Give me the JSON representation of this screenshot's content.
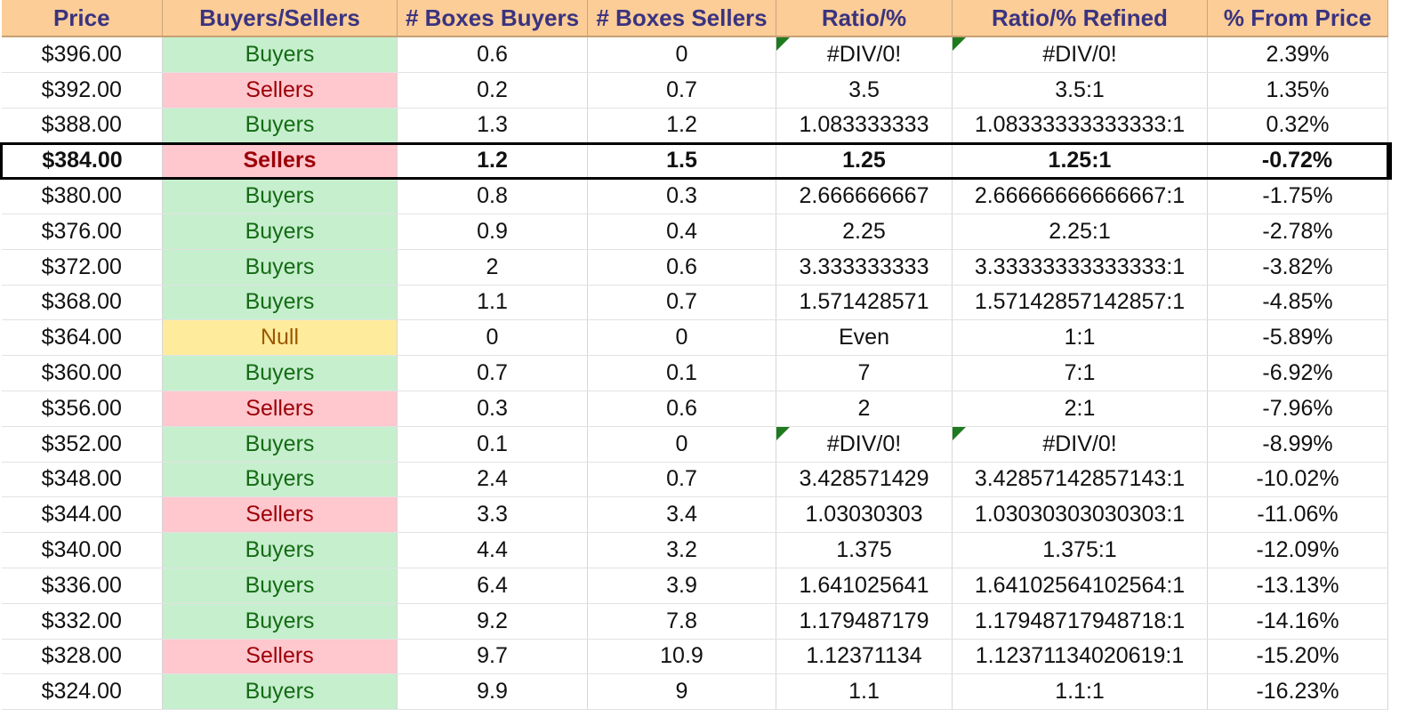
{
  "columns": [
    "Price",
    "Buyers/Sellers",
    "# Boxes Buyers",
    "# Boxes Sellers",
    "Ratio/%",
    "Ratio/% Refined",
    "% From Price"
  ],
  "current_row_index": 3,
  "colors": {
    "header_bg": "#fccd97",
    "header_text": "#3a3380",
    "buyers_bg": "#c6efce",
    "buyers_text": "#146b14",
    "sellers_bg": "#ffc7ce",
    "sellers_text": "#9c0006",
    "null_bg": "#ffeb9c",
    "null_text": "#9c5700",
    "error_flag": "#1f7a1f"
  },
  "rows": [
    {
      "price": "$396.00",
      "bs": "Buyers",
      "boxes_buyers": "0.6",
      "boxes_sellers": "0",
      "ratio": "#DIV/0!",
      "ratio_refined": "#DIV/0!",
      "from_price": "2.39%",
      "flag": true
    },
    {
      "price": "$392.00",
      "bs": "Sellers",
      "boxes_buyers": "0.2",
      "boxes_sellers": "0.7",
      "ratio": "3.5",
      "ratio_refined": "3.5:1",
      "from_price": "1.35%"
    },
    {
      "price": "$388.00",
      "bs": "Buyers",
      "boxes_buyers": "1.3",
      "boxes_sellers": "1.2",
      "ratio": "1.083333333",
      "ratio_refined": "1.08333333333333:1",
      "from_price": "0.32%"
    },
    {
      "price": "$384.00",
      "bs": "Sellers",
      "boxes_buyers": "1.2",
      "boxes_sellers": "1.5",
      "ratio": "1.25",
      "ratio_refined": "1.25:1",
      "from_price": "-0.72%"
    },
    {
      "price": "$380.00",
      "bs": "Buyers",
      "boxes_buyers": "0.8",
      "boxes_sellers": "0.3",
      "ratio": "2.666666667",
      "ratio_refined": "2.66666666666667:1",
      "from_price": "-1.75%"
    },
    {
      "price": "$376.00",
      "bs": "Buyers",
      "boxes_buyers": "0.9",
      "boxes_sellers": "0.4",
      "ratio": "2.25",
      "ratio_refined": "2.25:1",
      "from_price": "-2.78%"
    },
    {
      "price": "$372.00",
      "bs": "Buyers",
      "boxes_buyers": "2",
      "boxes_sellers": "0.6",
      "ratio": "3.333333333",
      "ratio_refined": "3.33333333333333:1",
      "from_price": "-3.82%"
    },
    {
      "price": "$368.00",
      "bs": "Buyers",
      "boxes_buyers": "1.1",
      "boxes_sellers": "0.7",
      "ratio": "1.571428571",
      "ratio_refined": "1.57142857142857:1",
      "from_price": "-4.85%"
    },
    {
      "price": "$364.00",
      "bs": "Null",
      "boxes_buyers": "0",
      "boxes_sellers": "0",
      "ratio": "Even",
      "ratio_refined": "1:1",
      "from_price": "-5.89%"
    },
    {
      "price": "$360.00",
      "bs": "Buyers",
      "boxes_buyers": "0.7",
      "boxes_sellers": "0.1",
      "ratio": "7",
      "ratio_refined": "7:1",
      "from_price": "-6.92%"
    },
    {
      "price": "$356.00",
      "bs": "Sellers",
      "boxes_buyers": "0.3",
      "boxes_sellers": "0.6",
      "ratio": "2",
      "ratio_refined": "2:1",
      "from_price": "-7.96%"
    },
    {
      "price": "$352.00",
      "bs": "Buyers",
      "boxes_buyers": "0.1",
      "boxes_sellers": "0",
      "ratio": "#DIV/0!",
      "ratio_refined": "#DIV/0!",
      "from_price": "-8.99%",
      "flag": true
    },
    {
      "price": "$348.00",
      "bs": "Buyers",
      "boxes_buyers": "2.4",
      "boxes_sellers": "0.7",
      "ratio": "3.428571429",
      "ratio_refined": "3.42857142857143:1",
      "from_price": "-10.02%"
    },
    {
      "price": "$344.00",
      "bs": "Sellers",
      "boxes_buyers": "3.3",
      "boxes_sellers": "3.4",
      "ratio": "1.03030303",
      "ratio_refined": "1.03030303030303:1",
      "from_price": "-11.06%"
    },
    {
      "price": "$340.00",
      "bs": "Buyers",
      "boxes_buyers": "4.4",
      "boxes_sellers": "3.2",
      "ratio": "1.375",
      "ratio_refined": "1.375:1",
      "from_price": "-12.09%"
    },
    {
      "price": "$336.00",
      "bs": "Buyers",
      "boxes_buyers": "6.4",
      "boxes_sellers": "3.9",
      "ratio": "1.641025641",
      "ratio_refined": "1.64102564102564:1",
      "from_price": "-13.13%"
    },
    {
      "price": "$332.00",
      "bs": "Buyers",
      "boxes_buyers": "9.2",
      "boxes_sellers": "7.8",
      "ratio": "1.179487179",
      "ratio_refined": "1.17948717948718:1",
      "from_price": "-14.16%"
    },
    {
      "price": "$328.00",
      "bs": "Sellers",
      "boxes_buyers": "9.7",
      "boxes_sellers": "10.9",
      "ratio": "1.12371134",
      "ratio_refined": "1.12371134020619:1",
      "from_price": "-15.20%"
    },
    {
      "price": "$324.00",
      "bs": "Buyers",
      "boxes_buyers": "9.9",
      "boxes_sellers": "9",
      "ratio": "1.1",
      "ratio_refined": "1.1:1",
      "from_price": "-16.23%"
    }
  ]
}
